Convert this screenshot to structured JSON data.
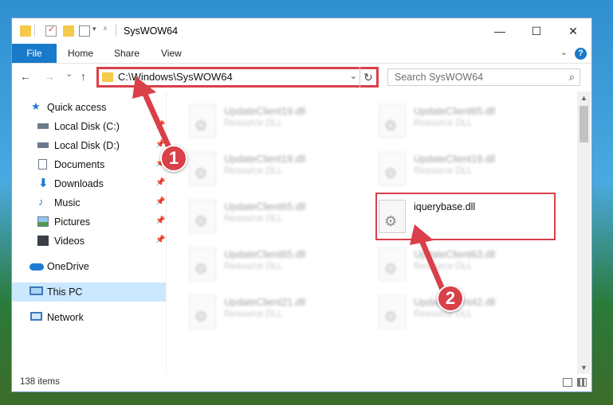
{
  "window": {
    "title": "SysWOW64",
    "minimize": "—",
    "maximize": "☐",
    "close": "✕"
  },
  "ribbon": {
    "file": "File",
    "home": "Home",
    "share": "Share",
    "view": "View",
    "help": "?"
  },
  "nav": {
    "back": "←",
    "forward": "→",
    "recent": "⌄",
    "up": "↑",
    "address": "C:\\Windows\\SysWOW64",
    "dropdown": "⌄",
    "refresh": "↻",
    "search_placeholder": "Search SysWOW64",
    "search_icon": "⌕"
  },
  "sidebar": {
    "items": [
      {
        "label": "Quick access",
        "icon": "star-icon",
        "pinned": false
      },
      {
        "label": "Local Disk (C:)",
        "icon": "drive-icon",
        "pinned": true
      },
      {
        "label": "Local Disk (D:)",
        "icon": "drive-icon",
        "pinned": true
      },
      {
        "label": "Documents",
        "icon": "documents-icon",
        "pinned": true
      },
      {
        "label": "Downloads",
        "icon": "download-icon",
        "pinned": true
      },
      {
        "label": "Music",
        "icon": "music-icon",
        "pinned": true
      },
      {
        "label": "Pictures",
        "icon": "pictures-icon",
        "pinned": true
      },
      {
        "label": "Videos",
        "icon": "videos-icon",
        "pinned": true
      },
      {
        "label": "OneDrive",
        "icon": "cloud-icon",
        "pinned": false
      },
      {
        "label": "This PC",
        "icon": "computer-icon",
        "pinned": false,
        "selected": true
      },
      {
        "label": "Network",
        "icon": "network-icon",
        "pinned": false
      }
    ]
  },
  "files": [
    {
      "name": "UpdateClient19.dll",
      "type": "Resource DLL"
    },
    {
      "name": "UpdateClient65.dll",
      "type": "Resource DLL"
    },
    {
      "name": "UpdateClient19.dll",
      "type": "Resource DLL"
    },
    {
      "name": "UpdateClient19.dll",
      "type": "Resource DLL"
    },
    {
      "name": "UpdateClient65.dll",
      "type": "Resource DLL"
    },
    {
      "name": "iquerybase.dll",
      "type": ""
    },
    {
      "name": "UpdateClient65.dll",
      "type": "Resource DLL"
    },
    {
      "name": "UpdateClient63.dll",
      "type": "Resource DLL"
    },
    {
      "name": "UpdateClient21.dll",
      "type": "Resource DLL"
    },
    {
      "name": "UpdateClient42.dll",
      "type": "Resource DLL"
    }
  ],
  "status": {
    "items": "138 items"
  },
  "annotations": {
    "step1": "1",
    "step2": "2",
    "color": "#d9404a"
  }
}
